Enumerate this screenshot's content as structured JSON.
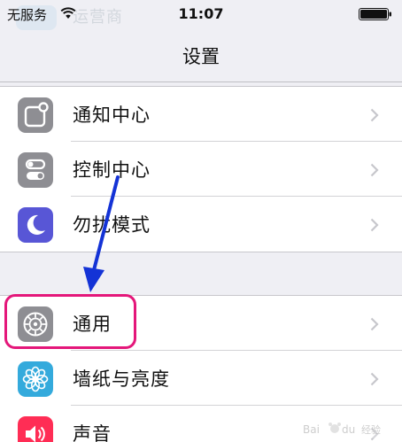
{
  "status_bar": {
    "carrier": "无服务",
    "time": "11:07",
    "behind_text": "运营商"
  },
  "nav": {
    "title": "设置"
  },
  "groups": [
    {
      "items": [
        {
          "label": "通知中心",
          "icon": "notification-center-icon",
          "color": "#8e8e93"
        },
        {
          "label": "控制中心",
          "icon": "control-center-icon",
          "color": "#8e8e93"
        },
        {
          "label": "勿扰模式",
          "icon": "moon-icon",
          "color": "#5856d6"
        }
      ]
    },
    {
      "items": [
        {
          "label": "通用",
          "icon": "gear-icon",
          "color": "#8e8e93"
        },
        {
          "label": "墙纸与亮度",
          "icon": "wallpaper-icon",
          "color": "#34aadc"
        },
        {
          "label": "声音",
          "icon": "sound-icon",
          "color": "#ff2d55"
        }
      ]
    }
  ],
  "annotation": {
    "color": "#e4177a",
    "arrow_color": "#1433d6"
  },
  "watermark": {
    "text": "Baidu 经验"
  }
}
